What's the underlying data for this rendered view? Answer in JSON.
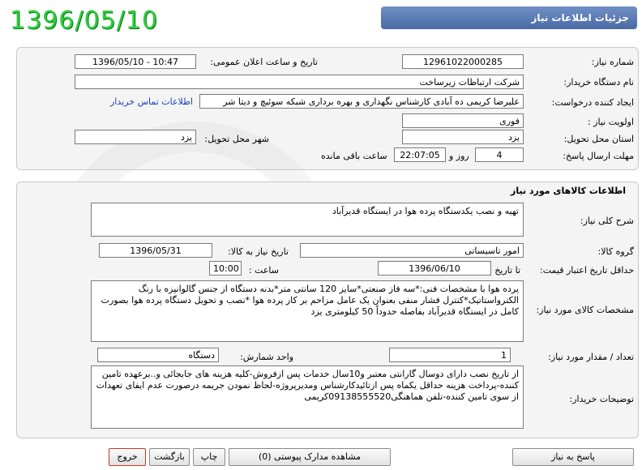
{
  "header": {
    "title": "جزئیات اطلاعات نیاز",
    "date_stamp": "1396/05/10"
  },
  "watermark": {
    "text": "هزاره"
  },
  "fields": {
    "need_number_label": "شماره نیاز:",
    "need_number": "12961022000285",
    "announce_label": "تاریخ و ساعت اعلان عمومی:",
    "announce_value": "1396/05/10 - 10:47",
    "buyer_label": "نام دستگاه خریدار:",
    "buyer_value": "شرکت ارتباطات زیرساخت",
    "creator_label": "ایجاد کننده درخواست:",
    "creator_value": "علیرضا کریمی ده آبادی کارشناس نگهداری و بهره برداری شبکه سوئیچ و دیتا شر",
    "contact_link": "اطلاعات تماس خریدار",
    "priority_label": "اولویت نیاز :",
    "priority_value": "فوری",
    "province_label": "استان محل تحویل:",
    "province_value": "یزد",
    "city_label": "شهر محل تحویل:",
    "city_value": "یزد",
    "deadline_label": "مهلت ارسال پاسخ:",
    "deadline_days": "4",
    "deadline_and": "روز و",
    "deadline_time": "22:07:05",
    "deadline_remaining": "ساعت باقی مانده"
  },
  "goods": {
    "section_title": "اطلاعات کالاهای مورد نیاز",
    "general_desc_label": "شرح کلی نیاز:",
    "general_desc": "تهیه و نصب یکدستگاه پرده هوا در ایستگاه قدیرآباد",
    "group_label": "گروه کالا:",
    "group_value": "امور تاسیساتی",
    "need_date_label": "تاریخ نیاز به کالا:",
    "need_date": "1396/05/31",
    "min_validity_label": "حداقل تاریخ اعتبار قیمت:",
    "until_date_label": "تا تاریخ :",
    "until_date": "1396/06/10",
    "time_label": "ساعت :",
    "time_value": "10:00",
    "specs_label": "مشخصات کالای مورد نیاز:",
    "specs_text": "پرده هوا با مشخصات فنی:*سه فاز صنعتی*سایز 120 سانتی متر*بدنه دستگاه از جنس گالوانیزه با رنگ الکترواستاتیک*کنترل فشار منفی بعنوان یک عامل مزاحم بر کار پرده هوا *نصب و تحویل دستگاه پرده هوا بصورت کامل در ایستگاه قدیرآباد بفاصله حدوداً 50 کیلومتری یزد",
    "qty_label": "تعداد / مقدار مورد نیاز:",
    "qty_value": "1",
    "unit_label": "واحد شمارش:",
    "unit_value": "دستگاه",
    "buyer_notes_label": "توضیحات خریدار:",
    "buyer_notes": "از تاریخ نصب دارای دوسال گارانتی معتبر و10سال خدمات پس ازفروش-کلیه هزینه های جابجائی و..برعهده تامین کننده-پرداخت هزینه حداقل یکماه پس ازتائیدکارشناس ومدیرپروژه-لحاظ نمودن جریمه درصورت عدم ایفای تعهدات از سوی تامین کننده-تلفن هماهنگی09138555520کریمی"
  },
  "buttons": {
    "reply": "پاسخ به نیاز",
    "attachments": "مشاهده مدارک پیوستی (0)",
    "print": "چاپ",
    "back": "بازگشت",
    "exit": "خروج"
  }
}
